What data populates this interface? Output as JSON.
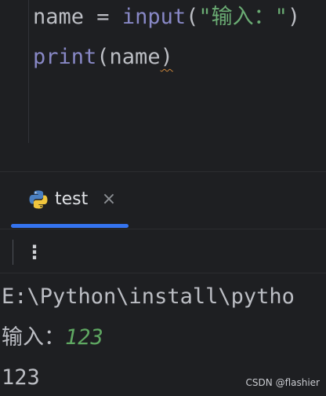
{
  "editor": {
    "line1": {
      "var": "name",
      "op": " = ",
      "func": "input",
      "open": "(",
      "string": "\"输入：\"",
      "close": ")"
    },
    "line2": {
      "func": "print",
      "open": "(",
      "arg": "name",
      "close": ")"
    }
  },
  "run_window": {
    "tab": {
      "label": "test",
      "icon": "python-icon",
      "close_label": "×"
    },
    "toolbar": {
      "menu_label": "⋮"
    },
    "console": {
      "line1": "E:\\Python\\install\\pytho",
      "line2_prompt": "输入：",
      "line2_input": "123",
      "line3": "123"
    }
  },
  "watermark": "CSDN @flashier",
  "colors": {
    "background": "#1e1f22",
    "keyword_fn": "#8888c6",
    "string": "#6aab73",
    "accent": "#3574f0",
    "user_input": "#5fa862"
  }
}
